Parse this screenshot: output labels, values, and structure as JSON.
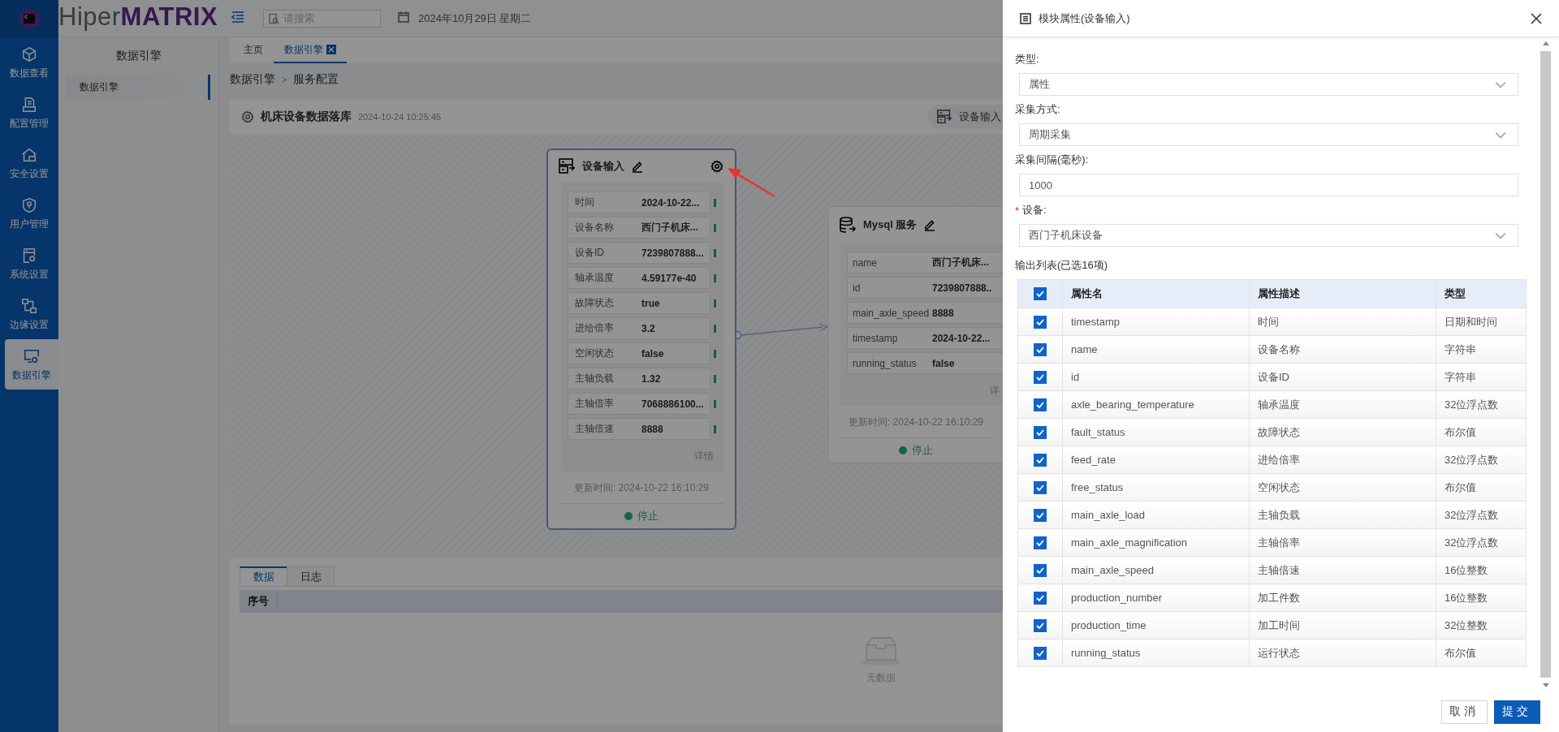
{
  "header": {
    "logo_text_1": "Hiper",
    "logo_text_2": "MATRIX",
    "search": {
      "placeholder": "请搜索"
    },
    "date": "2024年10月29日 星期二"
  },
  "nav": [
    {
      "label": "数据查看",
      "selected": false
    },
    {
      "label": "配置管理",
      "selected": false
    },
    {
      "label": "安全设置",
      "selected": false
    },
    {
      "label": "用户管理",
      "selected": false
    },
    {
      "label": "系统设置",
      "selected": false
    },
    {
      "label": "边缘设置",
      "selected": false
    },
    {
      "label": "数据引擎",
      "selected": true
    }
  ],
  "sidebar": {
    "title": "数据引擎",
    "items": [
      {
        "label": "数据引擎",
        "selected": true
      }
    ]
  },
  "tabs": [
    {
      "label": "主页",
      "selected": false,
      "closable": false
    },
    {
      "label": "数据引擎",
      "selected": true,
      "closable": true
    }
  ],
  "breadcrumb": {
    "items": [
      "数据引擎",
      "服务配置"
    ],
    "separator": ">"
  },
  "flow": {
    "title": "机床设备数据落库",
    "time": "2024-10-24 10:25:45",
    "toolbar_button": "设备输入",
    "nodes": [
      {
        "kind": "input",
        "title": "设备输入",
        "fields": [
          {
            "label": "时间",
            "value": "2024-10-22..."
          },
          {
            "label": "设备名称",
            "value": "西门子机床..."
          },
          {
            "label": "设备ID",
            "value": "7239807888..."
          },
          {
            "label": "轴承温度",
            "value": "4.59177e-40"
          },
          {
            "label": "故障状态",
            "value": "true"
          },
          {
            "label": "进给倍率",
            "value": "3.2"
          },
          {
            "label": "空闲状态",
            "value": "false"
          },
          {
            "label": "主轴负载",
            "value": "1.32"
          },
          {
            "label": "主轴倍率",
            "value": "7068886100..."
          },
          {
            "label": "主轴倍速",
            "value": "8888"
          }
        ],
        "link": "详情",
        "updated": "更新时间: 2024-10-22 16:10:29",
        "status": {
          "label": "停止"
        }
      },
      {
        "kind": "output",
        "title": "Mysql 服务",
        "fields": [
          {
            "label": "name",
            "value": "西门子机床..."
          },
          {
            "label": "id",
            "value": "7239807888.."
          },
          {
            "label": "main_axle_speed",
            "value": "8888"
          },
          {
            "label": "timestamp",
            "value": "2024-10-22..."
          },
          {
            "label": "running_status",
            "value": "false"
          }
        ],
        "link": "详",
        "updated": "更新时间: 2024-10-22 16:10:29",
        "status": {
          "label": "停止"
        }
      }
    ]
  },
  "bottom_panel": {
    "tabs": [
      {
        "label": "数据",
        "selected": true
      },
      {
        "label": "日志",
        "selected": false
      }
    ],
    "columns": [
      "序号"
    ],
    "empty_text": "无数据"
  },
  "drawer": {
    "title": "模块属性(设备输入)",
    "fields": [
      {
        "label": "类型:",
        "kind": "select",
        "value": "属性"
      },
      {
        "label": "采集方式:",
        "kind": "select",
        "value": "周期采集"
      },
      {
        "label": "采集间隔(毫秒):",
        "kind": "input",
        "value": "1000"
      },
      {
        "label": "设备:",
        "kind": "select",
        "value": "西门子机床设备",
        "required_mark": "*"
      }
    ],
    "output_list": {
      "title": "输出列表(已选16项)",
      "all_checked": true,
      "columns": [
        "属性名",
        "属性描述",
        "类型"
      ],
      "rows": [
        {
          "checked": true,
          "name": "timestamp",
          "description": "时间",
          "type": "日期和时间"
        },
        {
          "checked": true,
          "name": "name",
          "description": "设备名称",
          "type": "字符串"
        },
        {
          "checked": true,
          "name": "id",
          "description": "设备ID",
          "type": "字符串"
        },
        {
          "checked": true,
          "name": "axle_bearing_temperature",
          "description": "轴承温度",
          "type": "32位浮点数"
        },
        {
          "checked": true,
          "name": "fault_status",
          "description": "故障状态",
          "type": "布尔值"
        },
        {
          "checked": true,
          "name": "feed_rate",
          "description": "进给倍率",
          "type": "32位浮点数"
        },
        {
          "checked": true,
          "name": "free_status",
          "description": "空闲状态",
          "type": "布尔值"
        },
        {
          "checked": true,
          "name": "main_axle_load",
          "description": "主轴负载",
          "type": "32位浮点数"
        },
        {
          "checked": true,
          "name": "main_axle_magnification",
          "description": "主轴倍率",
          "type": "32位浮点数"
        },
        {
          "checked": true,
          "name": "main_axle_speed",
          "description": "主轴倍速",
          "type": "16位整数"
        },
        {
          "checked": true,
          "name": "production_number",
          "description": "加工件数",
          "type": "16位整数"
        },
        {
          "checked": true,
          "name": "production_time",
          "description": "加工时间",
          "type": "32位整数"
        },
        {
          "checked": true,
          "name": "running_status",
          "description": "运行状态",
          "type": "布尔值"
        }
      ]
    },
    "buttons": [
      {
        "label": "取消",
        "kind": "secondary"
      },
      {
        "label": "提交",
        "kind": "primary"
      }
    ]
  }
}
